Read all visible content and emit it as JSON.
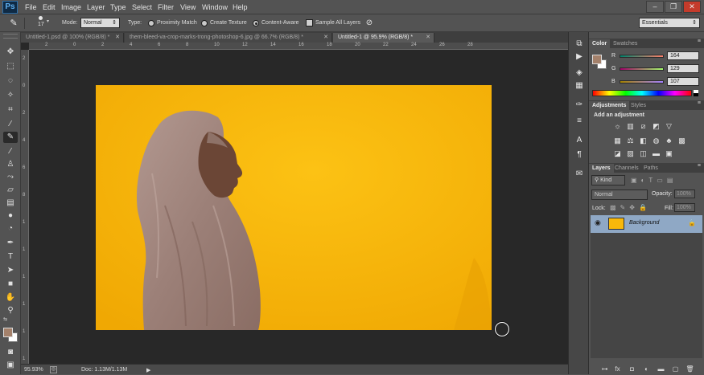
{
  "app": {
    "logo": "Ps"
  },
  "menu": [
    "File",
    "Edit",
    "Image",
    "Layer",
    "Type",
    "Select",
    "Filter",
    "View",
    "Window",
    "Help"
  ],
  "window_controls": {
    "minimize": "–",
    "restore": "❐",
    "close": "✕"
  },
  "options_bar": {
    "brush_size": "17",
    "mode_label": "Mode:",
    "mode_value": "Normal",
    "type_label": "Type:",
    "type_options": [
      "Proximity Match",
      "Create Texture",
      "Content-Aware"
    ],
    "selected_type": "Content-Aware",
    "sample_all_layers": "Sample All Layers",
    "workspace": "Essentials"
  },
  "tabs": [
    {
      "label": "Untitled-1.psd @ 100% (RGB/8) *",
      "active": false
    },
    {
      "label": "them-bleed-va-crop-marks-trong-photoshop-6.jpg @ 66.7% (RGB/8) *",
      "active": false
    },
    {
      "label": "Untitled-1 @ 95.9% (RGB/8) *",
      "active": true
    }
  ],
  "ruler_top": [
    "2",
    "0",
    "2",
    "4",
    "6",
    "8",
    "10",
    "12",
    "14",
    "16",
    "18",
    "20",
    "22",
    "24",
    "26",
    "28"
  ],
  "ruler_left": [
    "2",
    "0",
    "2",
    "4",
    "6",
    "8",
    "1",
    "1",
    "1",
    "1",
    "1",
    "1"
  ],
  "status": {
    "zoom": "95.93%",
    "doc": "Doc: 1.13M/1.13M"
  },
  "color_panel": {
    "tabs": [
      "Color",
      "Swatches"
    ],
    "channels": [
      {
        "name": "R",
        "value": "164"
      },
      {
        "name": "G",
        "value": "129"
      },
      {
        "name": "B",
        "value": "107"
      }
    ],
    "foreground": "#a4816b",
    "background": "#ffffff"
  },
  "adjustments_panel": {
    "tabs": [
      "Adjustments",
      "Styles"
    ],
    "title": "Add an adjustment"
  },
  "layers_panel": {
    "tabs": [
      "Layers",
      "Channels",
      "Paths"
    ],
    "filter": "Kind",
    "blend_mode": "Normal",
    "opacity_label": "Opacity:",
    "opacity_value": "100%",
    "lock_label": "Lock:",
    "fill_label": "Fill:",
    "fill_value": "100%",
    "layer_name": "Background"
  },
  "colors": {
    "image_bg": "#f8b80a",
    "selected_layer": "#8fa8c5"
  }
}
